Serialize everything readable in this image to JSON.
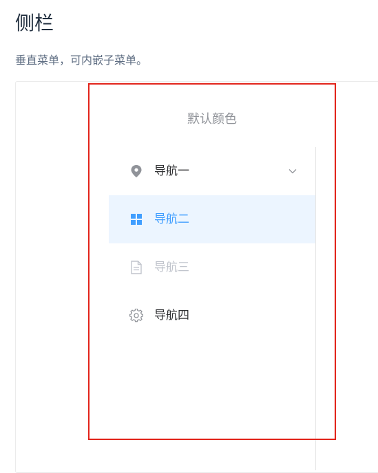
{
  "page": {
    "title": "侧栏",
    "description": "垂直菜单，可内嵌子菜单。"
  },
  "menu": {
    "heading": "默认颜色",
    "items": [
      {
        "label": "导航一",
        "icon": "location-icon",
        "state": "normal",
        "has_submenu": true
      },
      {
        "label": "导航二",
        "icon": "grid-menu-icon",
        "state": "active",
        "has_submenu": false
      },
      {
        "label": "导航三",
        "icon": "document-icon",
        "state": "disabled",
        "has_submenu": false
      },
      {
        "label": "导航四",
        "icon": "gear-icon",
        "state": "normal",
        "has_submenu": false
      }
    ]
  },
  "colors": {
    "active_text": "#409eff",
    "active_bg": "#ecf5ff",
    "disabled_text": "#c0c4cc",
    "highlight_border": "#e2231a"
  }
}
